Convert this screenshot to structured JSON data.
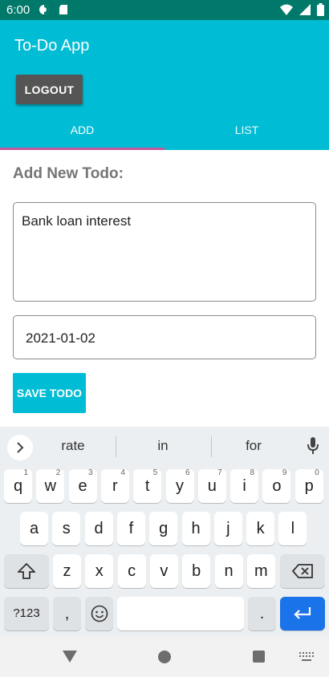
{
  "status_bar": {
    "time": "6:00"
  },
  "app": {
    "title": "To-Do App",
    "logout_label": "LOGOUT",
    "tabs": [
      {
        "label": "ADD"
      },
      {
        "label": "LIST"
      }
    ],
    "accent_color": "#00bcd4",
    "indicator_color": "#c2579a"
  },
  "form": {
    "heading": "Add New Todo:",
    "todo_text": "Bank loan interest",
    "date_value": "2021-01-02",
    "save_label": "SAVE TODO"
  },
  "keyboard": {
    "suggestions": [
      "rate",
      "in",
      "for"
    ],
    "row1": [
      {
        "k": "q",
        "h": "1"
      },
      {
        "k": "w",
        "h": "2"
      },
      {
        "k": "e",
        "h": "3"
      },
      {
        "k": "r",
        "h": "4"
      },
      {
        "k": "t",
        "h": "5"
      },
      {
        "k": "y",
        "h": "6"
      },
      {
        "k": "u",
        "h": "7"
      },
      {
        "k": "i",
        "h": "8"
      },
      {
        "k": "o",
        "h": "9"
      },
      {
        "k": "p",
        "h": "0"
      }
    ],
    "row2": [
      "a",
      "s",
      "d",
      "f",
      "g",
      "h",
      "j",
      "k",
      "l"
    ],
    "row3": [
      "z",
      "x",
      "c",
      "v",
      "b",
      "n",
      "m"
    ],
    "symbols_label": "?123",
    "comma_label": ",",
    "period_label": "."
  }
}
